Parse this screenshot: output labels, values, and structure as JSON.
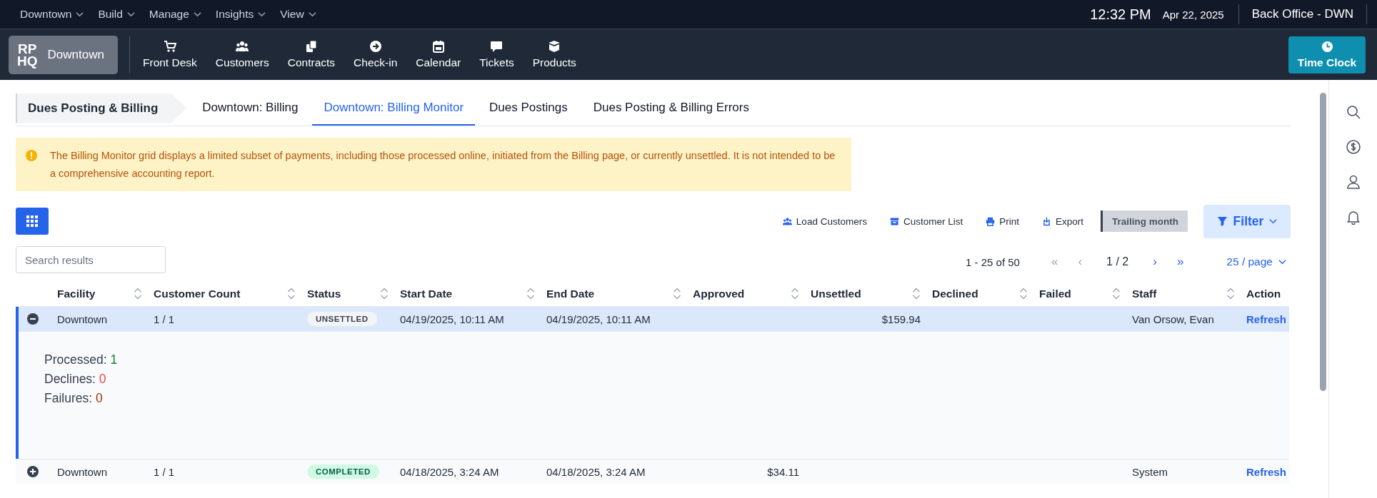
{
  "top_nav": {
    "menus": [
      {
        "label": "Downtown"
      },
      {
        "label": "Build"
      },
      {
        "label": "Manage"
      },
      {
        "label": "Insights"
      },
      {
        "label": "View"
      }
    ],
    "time": "12:32 PM",
    "date": "Apr 22, 2025",
    "location": "Back Office - DWN"
  },
  "app_bar": {
    "logo": [
      "RP",
      "HQ"
    ],
    "site": "Downtown",
    "apps": [
      {
        "label": "Front Desk"
      },
      {
        "label": "Customers"
      },
      {
        "label": "Contracts"
      },
      {
        "label": "Check-in"
      },
      {
        "label": "Calendar"
      },
      {
        "label": "Tickets"
      },
      {
        "label": "Products"
      }
    ],
    "time_clock": "Time Clock"
  },
  "breadcrumb": "Dues Posting & Billing",
  "tabs": [
    {
      "label": "Downtown: Billing",
      "selected": false
    },
    {
      "label": "Downtown: Billing Monitor",
      "selected": true
    },
    {
      "label": "Dues Postings",
      "selected": false
    },
    {
      "label": "Dues Posting & Billing Errors",
      "selected": false
    }
  ],
  "notice": {
    "text": "The Billing Monitor grid displays a limited subset of payments, including those processed online, initiated from the Billing page, or currently unsettled. It is not intended to be a comprehensive accounting report."
  },
  "actions": [
    {
      "label": "Load Customers"
    },
    {
      "label": "Customer List"
    },
    {
      "label": "Print"
    },
    {
      "label": "Export"
    }
  ],
  "period": "Trailing month",
  "filter": "Filter",
  "search": {
    "placeholder": "Search results"
  },
  "pagination": {
    "range": "1 - 25 of 50",
    "first": "«",
    "prev": "‹",
    "page": "1 / 2",
    "next": "›",
    "last": "»",
    "page_size": "25 / page"
  },
  "table": {
    "columns": [
      {
        "label": "Facility",
        "sortable": true,
        "kind": "text"
      },
      {
        "label": "Customer Count",
        "sortable": true,
        "kind": "text"
      },
      {
        "label": "Status",
        "sortable": true,
        "kind": "badge"
      },
      {
        "label": "Start Date",
        "sortable": true,
        "kind": "text"
      },
      {
        "label": "End Date",
        "sortable": true,
        "kind": "text"
      },
      {
        "label": "Approved",
        "sortable": true,
        "kind": "money"
      },
      {
        "label": "Unsettled",
        "sortable": true,
        "kind": "money"
      },
      {
        "label": "Declined",
        "sortable": true,
        "kind": "money"
      },
      {
        "label": "Failed",
        "sortable": true,
        "kind": "money"
      },
      {
        "label": "Staff",
        "sortable": true,
        "kind": "text"
      },
      {
        "label": "Action",
        "sortable": false,
        "kind": "action"
      }
    ],
    "rows": [
      {
        "expanded": true,
        "cells": [
          "Downtown",
          "1 / 1",
          {
            "label": "UNSETTLED",
            "kind": "unsettled"
          },
          "04/19/2025, 10:11 AM",
          "04/19/2025, 10:11 AM",
          null,
          "$159.94",
          null,
          null,
          "Van Orsow, Evan",
          "Refresh"
        ],
        "details": [
          {
            "label": "Processed:",
            "value": "1",
            "kind": "success"
          },
          {
            "label": "Declines:",
            "value": "0",
            "kind": "danger"
          },
          {
            "label": "Failures:",
            "value": "0",
            "kind": "warning"
          }
        ]
      },
      {
        "expanded": false,
        "cells": [
          "Downtown",
          "1 / 1",
          {
            "label": "COMPLETED",
            "kind": "completed"
          },
          "04/18/2025, 3:24 AM",
          "04/18/2025, 3:24 AM",
          "$34.11",
          null,
          null,
          null,
          "System",
          "Refresh"
        ]
      }
    ]
  }
}
